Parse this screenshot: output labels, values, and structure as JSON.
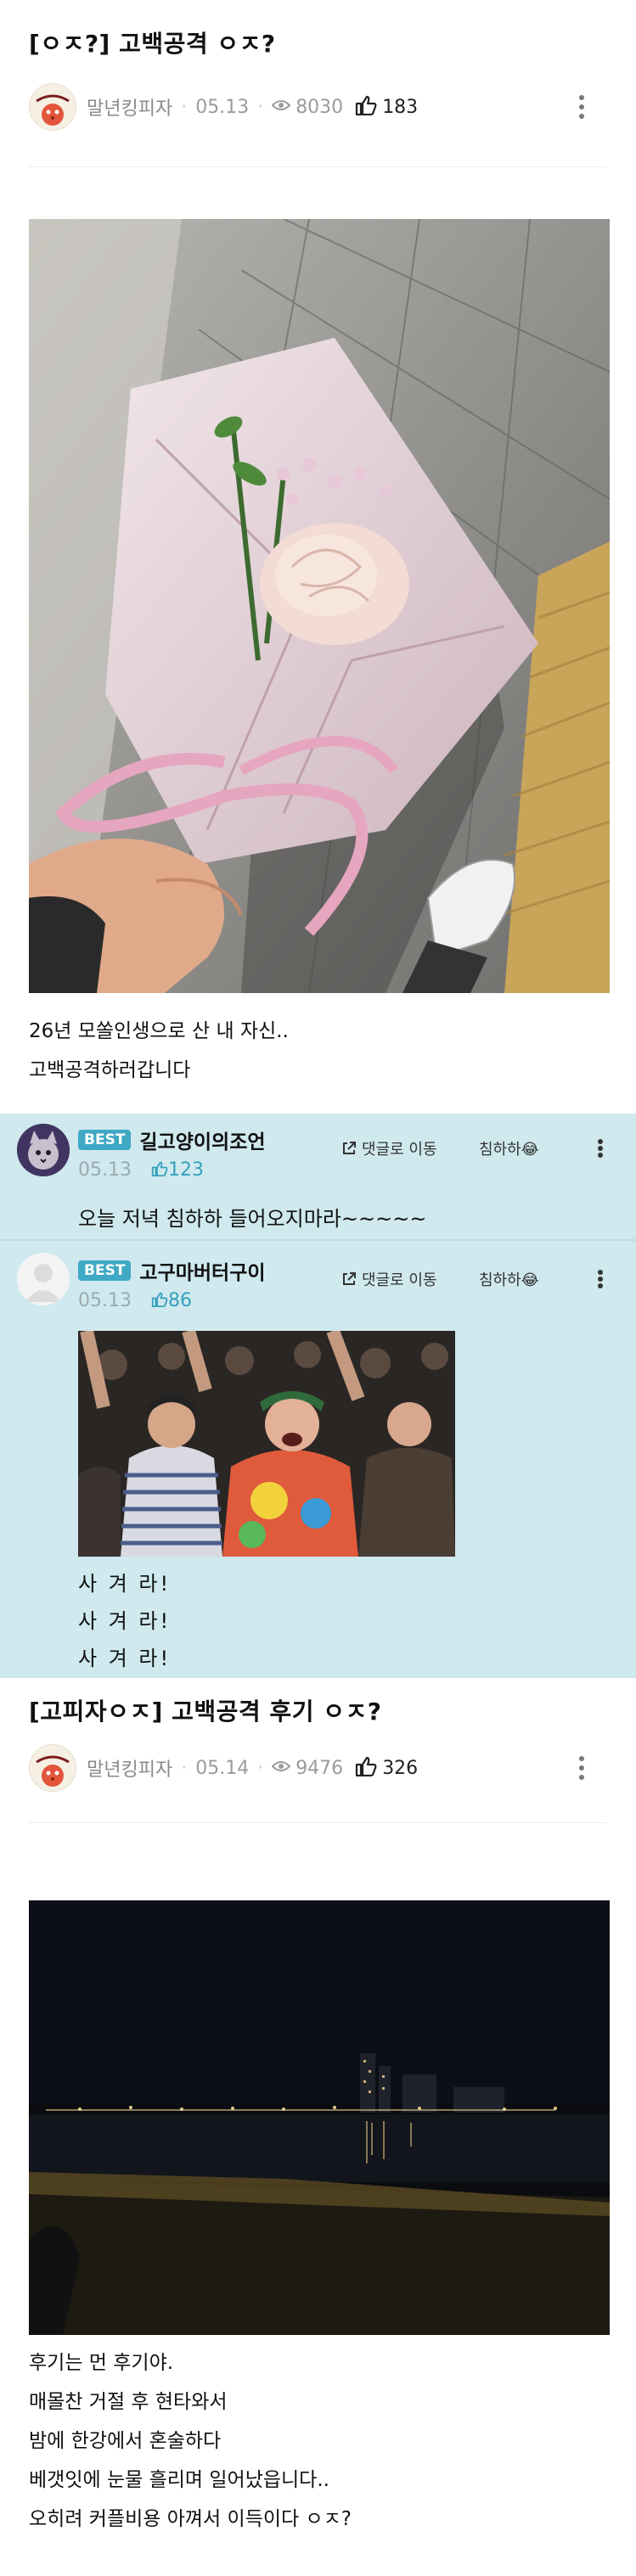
{
  "post1": {
    "title": "[ㅇㅈ?] 고백공격 ㅇㅈ?",
    "author": "말년킹피자",
    "date": "05.13",
    "views": "8030",
    "likes": "183",
    "body_lines": [
      "26년 모쏠인생으로 산 내 자신..",
      "고백공격하러갑니다"
    ]
  },
  "comments": [
    {
      "badge": "BEST",
      "name": "길고양이의조언",
      "date": "05.13",
      "likes": "123",
      "goto_label": "댓글로 이동",
      "react_label": "침하하😂",
      "text": "오늘 저녁 침하하 들어오지마라~~~~~"
    },
    {
      "badge": "BEST",
      "name": "고구마버터구이",
      "date": "05.13",
      "likes": "86",
      "goto_label": "댓글로 이동",
      "react_label": "침하하😂",
      "lines": [
        "사 겨 라!",
        "사 겨 라!",
        "사 겨 라!"
      ]
    }
  ],
  "post2": {
    "title": "[고피자ㅇㅈ] 고백공격 후기 ㅇㅈ?",
    "author": "말년킹피자",
    "date": "05.14",
    "views": "9476",
    "likes": "326",
    "body_lines": [
      "후기는 먼 후기야.",
      "매몰찬 거절 후 현타와서",
      "밤에 한강에서 혼술하다",
      "베갯잇에 눈물 흘리며 일어났읍니다..",
      "오히려 커플비용 아껴서 이득이다 ㅇㅈ?"
    ]
  },
  "colors": {
    "comment_bg": "#cfe9ee",
    "best_badge": "#3fa9c4",
    "like_blue": "#35a1bd"
  }
}
